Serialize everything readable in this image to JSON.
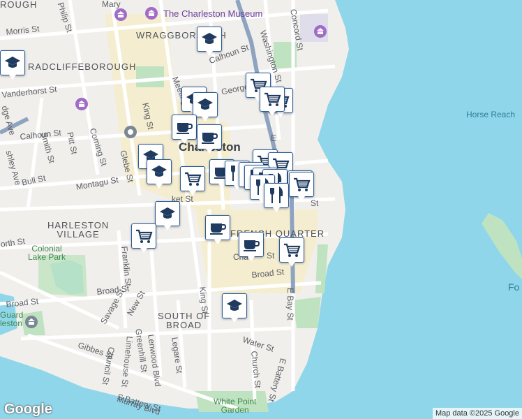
{
  "map": {
    "colors": {
      "land": "#f1efeb",
      "water": "#8fd6ea",
      "park": "#bfe3c1",
      "road": "#ffffff",
      "highway": "#8ea3bf",
      "commercial": "#f6ecc8",
      "marker_border": "#2a5d9a",
      "marker_icon": "#1f3b60"
    },
    "poi": {
      "charleston_museum": "The Charleston Museum"
    },
    "neighborhoods": {
      "wraggborough": "WRAGGBOROUGH",
      "radcliffeborough": "RADCLIFFEBOROUGH",
      "charleston": "Charleston",
      "harleston_village": "HARLESTON\nVILLAGE",
      "french_quarter": "FRENCH QUARTER",
      "south_of_broad": "SOUTH OF\nBROAD",
      "top_left": "ROUGH"
    },
    "water_labels": {
      "horse_reach": "Horse Reach",
      "fo": "Fo"
    },
    "parks": {
      "colonial_lake": "Colonial\nLake Park",
      "white_point": "White Point\nGarden",
      "guard": "Guard\nleston"
    },
    "streets": {
      "morris": "Morris St",
      "philip": "Philip St",
      "mary": "Mary",
      "calhoun_top": "Calhoun St",
      "calhoun_left": "Calhoun St",
      "washington": "Washington St",
      "concord": "Concord St",
      "vanderhorst": "Vanderhorst St",
      "george": "George St",
      "king_n": "King St",
      "meeting": "Meeting",
      "coming": "Coming St",
      "pitt": "Pitt St",
      "smith": "Smith St",
      "glebe": "Glebe St",
      "bull": "Bull St",
      "montagu": "Montagu St",
      "ashley": "shley Ave",
      "rutledge": "dge Ave",
      "east_bay_n": "E",
      "market": "ket St",
      "hasell": "St",
      "beaufain": "orth St",
      "franklin": "Franklin St",
      "chalmers": "Cha",
      "chalmers_st": "St",
      "broad_left": "Broad St",
      "broad_mid": "Broad St",
      "broad_right": "Broad St",
      "savage": "Savage St",
      "new": "New St",
      "king_s": "King St",
      "e_bay": "E Bay St",
      "gibbes": "Gibbes St",
      "council": "Council St",
      "limehouse": "Limehouse St",
      "greenhill": "Greenhill St",
      "lenwood": "Lenwood Blvd",
      "legare": "Legare St",
      "water": "Water St",
      "church": "Church St",
      "s_battery": "S Battery St",
      "e_battery": "E Battery St",
      "murray": "Murray Blvd"
    },
    "markers": [
      {
        "type": "school",
        "name": "school-marker"
      },
      {
        "type": "school",
        "name": "school-marker"
      },
      {
        "type": "shop",
        "name": "shop-marker"
      },
      {
        "type": "shop",
        "name": "shop-marker"
      },
      {
        "type": "shop",
        "name": "shop-marker"
      },
      {
        "type": "school",
        "name": "school-marker"
      },
      {
        "type": "school",
        "name": "school-marker"
      },
      {
        "type": "cafe",
        "name": "cafe-marker"
      },
      {
        "type": "cafe",
        "name": "cafe-marker"
      },
      {
        "type": "school",
        "name": "school-marker"
      },
      {
        "type": "school",
        "name": "school-marker"
      },
      {
        "type": "shop",
        "name": "shop-marker"
      },
      {
        "type": "cafe",
        "name": "cafe-marker"
      },
      {
        "type": "restaurant",
        "name": "restaurant-marker"
      },
      {
        "type": "shop",
        "name": "shop-marker"
      },
      {
        "type": "shop",
        "name": "shop-marker"
      },
      {
        "type": "restaurant",
        "name": "restaurant-marker"
      },
      {
        "type": "restaurant",
        "name": "restaurant-marker"
      },
      {
        "type": "restaurant",
        "name": "restaurant-marker"
      },
      {
        "type": "restaurant",
        "name": "restaurant-marker"
      },
      {
        "type": "shop",
        "name": "shop-marker"
      },
      {
        "type": "restaurant",
        "name": "restaurant-marker"
      },
      {
        "type": "restaurant",
        "name": "restaurant-marker"
      },
      {
        "type": "shop",
        "name": "shop-marker"
      },
      {
        "type": "school",
        "name": "school-marker"
      },
      {
        "type": "shop",
        "name": "shop-marker"
      },
      {
        "type": "cafe",
        "name": "cafe-marker"
      },
      {
        "type": "cafe",
        "name": "cafe-marker"
      },
      {
        "type": "shop",
        "name": "shop-marker"
      },
      {
        "type": "school",
        "name": "school-marker"
      }
    ]
  },
  "footer": {
    "logo": "Google",
    "attribution": "Map data ©2025 Google"
  }
}
